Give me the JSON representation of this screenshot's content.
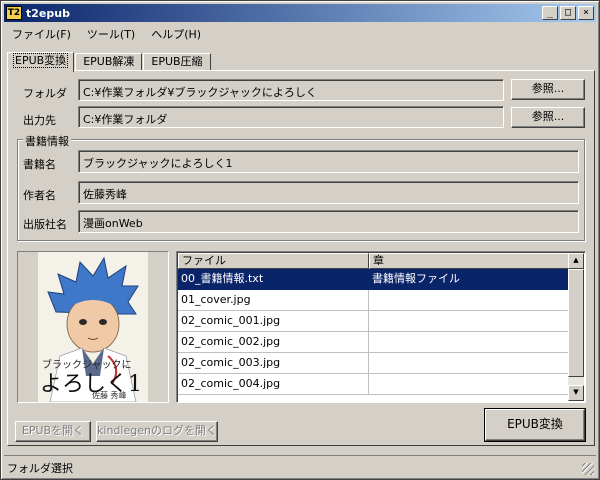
{
  "window": {
    "icon_text": "T2",
    "title": "t2epub",
    "minimize_glyph": "_",
    "maximize_glyph": "□",
    "close_glyph": "×"
  },
  "menu": [
    "ファイル(F)",
    "ツール(T)",
    "ヘルプ(H)"
  ],
  "tabs": [
    "EPUB変換",
    "EPUB解凍",
    "EPUB圧縮"
  ],
  "paths": {
    "folder_label": "フォルダ",
    "folder_value": "C:¥作業フォルダ¥ブラックジャックによろしく",
    "output_label": "出力先",
    "output_value": "C:¥作業フォルダ",
    "browse_label": "参照..."
  },
  "book_info": {
    "group_title": "書籍情報",
    "title_label": "書籍名",
    "title_value": "ブラックジャックによろしく1",
    "author_label": "作者名",
    "author_value": "佐藤秀峰",
    "publisher_label": "出版社名",
    "publisher_value": "漫画onWeb"
  },
  "cover": {
    "subtitle_text": "ブラックジャックに",
    "title_text": "よろしく1",
    "author_text": "佐藤 秀峰"
  },
  "file_list": {
    "columns": [
      "ファイル",
      "章"
    ],
    "rows": [
      {
        "file": "00_書籍情報.txt",
        "chapter": "書籍情報ファイル",
        "selected": true
      },
      {
        "file": "01_cover.jpg",
        "chapter": ""
      },
      {
        "file": "02_comic_001.jpg",
        "chapter": ""
      },
      {
        "file": "02_comic_002.jpg",
        "chapter": ""
      },
      {
        "file": "02_comic_003.jpg",
        "chapter": ""
      },
      {
        "file": "02_comic_004.jpg",
        "chapter": ""
      }
    ],
    "scroll_up": "▲",
    "scroll_down": "▼"
  },
  "actions": {
    "open_epub": "EPUBを開く",
    "open_kindlegen_log": "kindlegenのログを開く",
    "convert": "EPUB変換"
  },
  "status": {
    "text": "フォルダ選択"
  },
  "colors": {
    "selection": "#0a246a",
    "face": "#d4d0c8"
  }
}
